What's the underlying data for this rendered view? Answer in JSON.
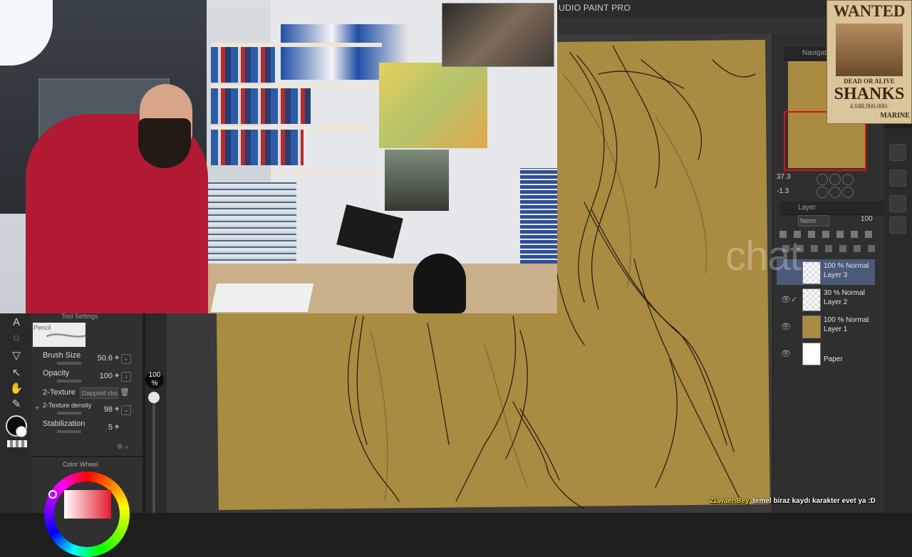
{
  "app": {
    "title": "UDIO PAINT PRO"
  },
  "navigator": {
    "title": "Navigat",
    "zoom": "37.3",
    "rotation": "-1.3"
  },
  "layers": {
    "title": "Layer",
    "blend_mode": "Norm",
    "opacity": "100",
    "items": [
      {
        "name": "Layer 3",
        "opacity_blend": "100 % Normal",
        "selected": true,
        "visible": false,
        "thumb": "transparent"
      },
      {
        "name": "Layer 2",
        "opacity_blend": "30 % Normal",
        "selected": false,
        "visible": true,
        "thumb": "transparent"
      },
      {
        "name": "Layer 1",
        "opacity_blend": "100 % Normal",
        "selected": false,
        "visible": true,
        "thumb": "#a98b41"
      },
      {
        "name": "Paper",
        "opacity_blend": "",
        "selected": false,
        "visible": true,
        "thumb": "#ffffff"
      }
    ]
  },
  "tool_settings": {
    "title": "Tool Settings",
    "brush_name": "Pencil",
    "brush_size_label": "Brush Size",
    "brush_size": "50.6",
    "opacity_label": "Opacity",
    "opacity": "100",
    "texture_label": "2-Texture",
    "texture_value": "Dappled clou",
    "texture_density_label": "2-Texture density",
    "texture_density": "98",
    "stabilization_label": "Stabilization",
    "stabilization": "5"
  },
  "brush_slider": {
    "badge": "100",
    "badge_unit": "%"
  },
  "color_wheel": {
    "title": "Color Wheel",
    "main_color": "#0c0c0c",
    "sub_color": "#ffffff"
  },
  "wanted_poster": {
    "title": "WANTED",
    "subtitle": "DEAD OR ALIVE",
    "name": "SHANKS",
    "bounty": "4.048.900.000-",
    "footer": "MARINE"
  },
  "overlay": {
    "watermark": "chat"
  },
  "chat": {
    "user": "ZLwaenBey",
    "message": "temel biraz kaydı karakter evet ya :D"
  },
  "colors": {
    "canvas": "#a98b41",
    "accent_selected": "#4a5a78",
    "navigator_frame": "#dd1111"
  }
}
